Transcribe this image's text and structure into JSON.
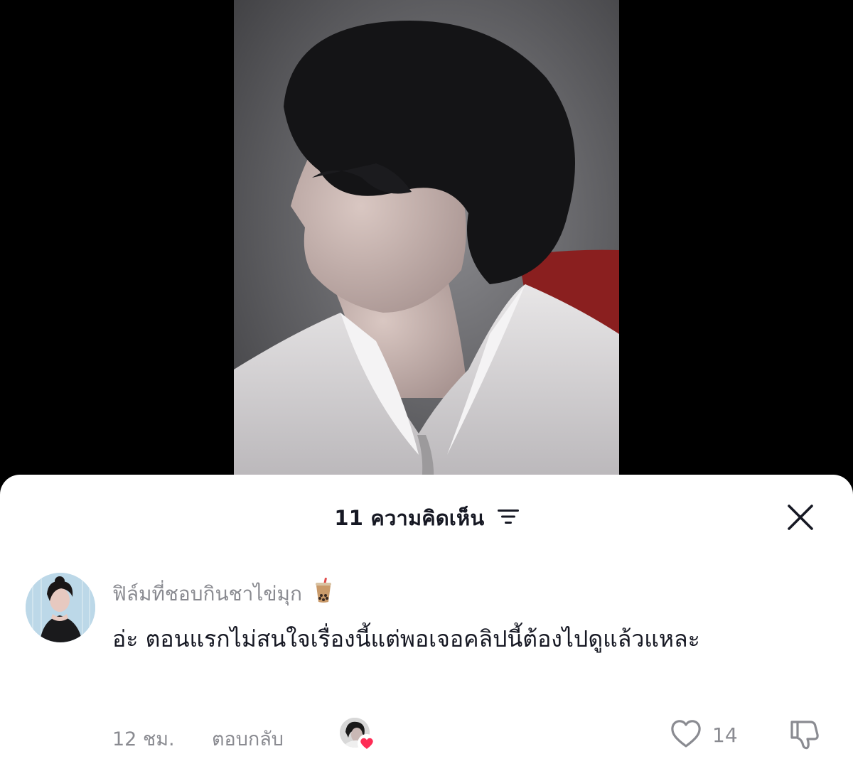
{
  "comments_sheet": {
    "count": "11",
    "title_label": "ความคิดเห็น",
    "sort_icon": "sort-lines-icon",
    "close_icon": "close-icon"
  },
  "comment": {
    "username": "ฟิล์มที่ชอบกินชาไข่มุก",
    "username_emoji": "bubble-tea-icon",
    "text": "อ่ะ ตอนแรกไม่สนใจเรื่องนี้แต่พอเจอคลิปนี้ต้องไปดูแล้วแหละ",
    "time": "12 ชม.",
    "reply_label": "ตอบกลับ",
    "like_count": "14",
    "liked_by_creator": true
  },
  "colors": {
    "primary_text": "#161823",
    "secondary_text": "#8a8b91",
    "heart_badge": "#fe2c55"
  }
}
